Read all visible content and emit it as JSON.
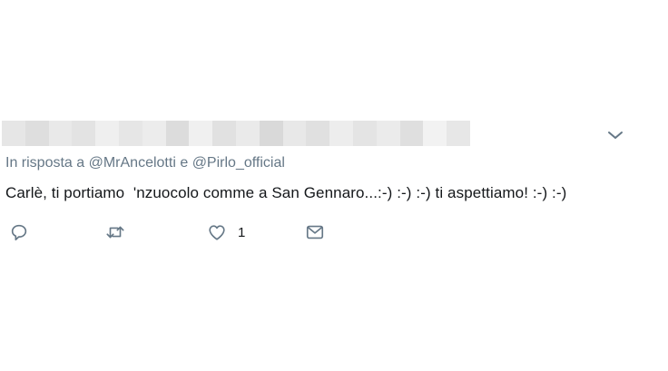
{
  "header": {
    "blurred_tiles": [
      "#e6e6e6",
      "#dedede",
      "#e9e9e9",
      "#e3e3e3",
      "#efefef",
      "#e6e6e6",
      "#ececec",
      "#dcdcdc",
      "#f0f0f0",
      "#e1e1e1",
      "#eaeaea",
      "#d9d9d9",
      "#e8e8e8",
      "#e0e0e0",
      "#ededed",
      "#e4e4e4",
      "#ebebeb",
      "#dfdfdf",
      "#f2f2f2",
      "#e7e7e7"
    ],
    "menu_icon": "chevron-down-icon"
  },
  "reply": {
    "prefix": "In risposta a",
    "mention1": "@MrAncelotti",
    "conj": "e",
    "mention2": "@Pirlo_official"
  },
  "tweet": {
    "text": "Carlè, ti portiamo  'nzuocolo comme a San Gennaro...:-) :-) :-) ti aspettiamo! :-) :-)"
  },
  "actions": {
    "reply_icon": "reply-icon",
    "retweet_icon": "retweet-icon",
    "like_icon": "heart-icon",
    "like_count": "1",
    "dm_icon": "envelope-icon"
  },
  "colors": {
    "text": "#14171a",
    "muted": "#657786",
    "icon": "#657786"
  }
}
